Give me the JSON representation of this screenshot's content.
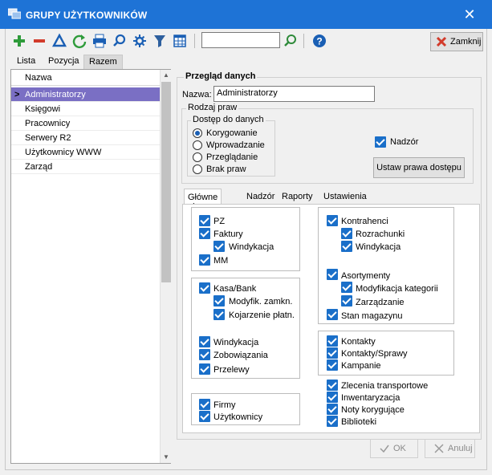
{
  "window": {
    "title": "GRUPY UŻYTKOWNIKÓW",
    "close_glyph": "✕"
  },
  "toolbar": {
    "icons": [
      "plus-icon",
      "minus-icon",
      "triangle-icon",
      "refresh-icon",
      "print-icon",
      "search-icon",
      "settings-icon",
      "filter-icon",
      "columns-icon",
      "search-go-icon",
      "help-icon"
    ],
    "search_value": "",
    "close_label": "Zamknij"
  },
  "top_tabs": [
    "Lista",
    "Pozycja",
    "Razem"
  ],
  "list": {
    "header": "Nazwa",
    "items": [
      "Administratorzy",
      "Księgowi",
      "Pracownicy",
      "Serwery R2",
      "Użytkownicy WWW",
      "Zarząd"
    ],
    "selected_marker": ">"
  },
  "details": {
    "section_title": "Przegląd danych",
    "name_label": "Nazwa:",
    "name_value": "Administratorzy",
    "rights_group": "Rodzaj praw",
    "access_group": "Dostęp do danych",
    "access_options": [
      "Korygowanie",
      "Wprowadzanie",
      "Przeglądanie",
      "Brak praw"
    ],
    "access_selected": "Korygowanie",
    "supervision_label": "Nadzór",
    "set_rights_button": "Ustaw prawa dostępu"
  },
  "inner_tabs": [
    "Główne okna",
    "Nadzór",
    "Raporty",
    "Ustawienia"
  ],
  "checks": {
    "pz": "PZ",
    "faktury": "Faktury",
    "windykacja_f": "Windykacja",
    "mm": "MM",
    "kasa_bank": "Kasa/Bank",
    "modyfik_zamkn": "Modyfik. zamkn.",
    "kojarzenie": "Kojarzenie płatn.",
    "windykacja": "Windykacja",
    "zobowiazania": "Zobowiązania",
    "przelewy": "Przelewy",
    "firmy": "Firmy",
    "uzytkownicy": "Użytkownicy",
    "kontrahenci": "Kontrahenci",
    "rozrachunki": "Rozrachunki",
    "windykacja_k": "Windykacja",
    "asortymenty": "Asortymenty",
    "modyfikacja_kategorii": "Modyfikacja kategorii",
    "zarzadzanie": "Zarządzanie",
    "stan_magazynu": "Stan magazynu",
    "kontakty": "Kontakty",
    "kontakty_sprawy": "Kontakty/Sprawy",
    "kampanie": "Kampanie",
    "zlecenia": "Zlecenia transportowe",
    "inwentaryzacja": "Inwentaryzacja",
    "noty": "Noty korygujące",
    "biblioteki": "Biblioteki"
  },
  "buttons": {
    "ok": "OK",
    "cancel": "Anuluj"
  },
  "colors": {
    "titlebar": "#1e73d6",
    "selection": "#7a6fc4",
    "checkbox": "#1a6fc9"
  }
}
